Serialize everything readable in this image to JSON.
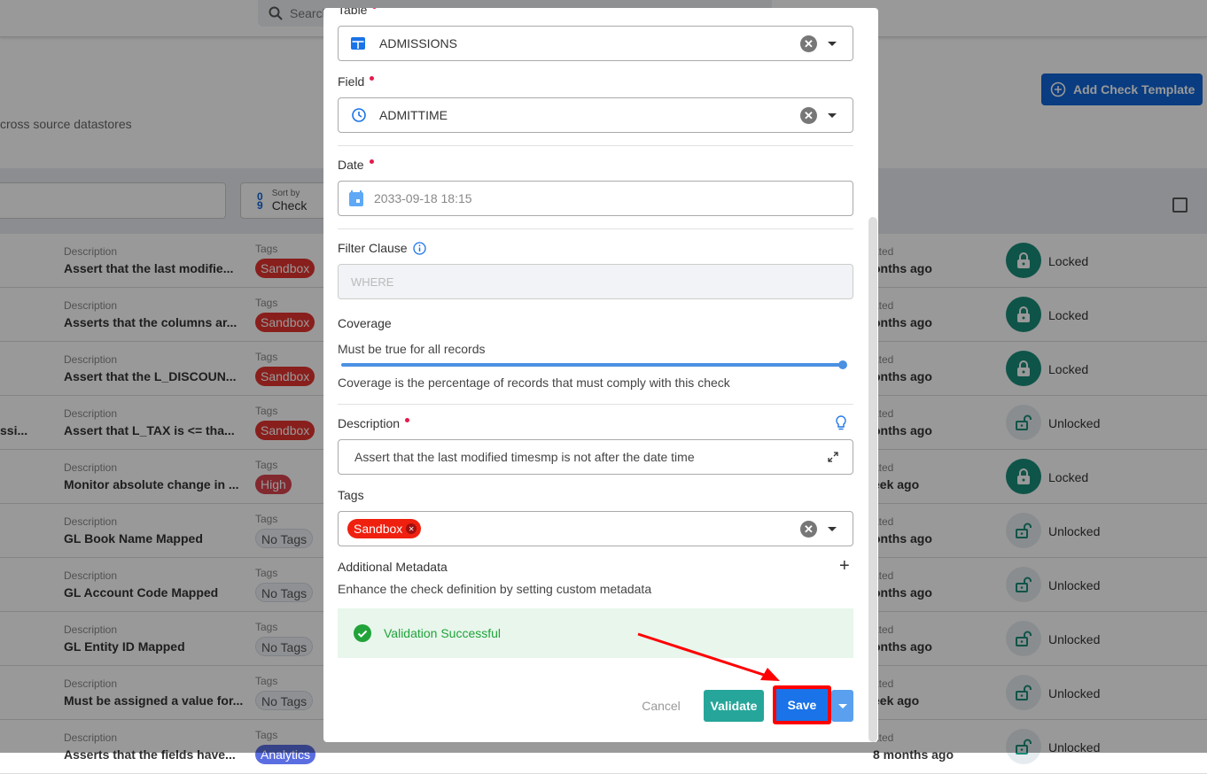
{
  "header": {
    "search_placeholder": "Search"
  },
  "page": {
    "subtitle": "cross source datastores",
    "add_button": "Add Check Template"
  },
  "toolbar": {
    "sort_label": "Sort by",
    "sort_value": "Check"
  },
  "rows": [
    {
      "desc_label": "Description",
      "desc": "Assert that the last modifie...",
      "tags_label": "Tags",
      "tag": "Sandbox",
      "tag_style": "red",
      "updated_label": "ated",
      "updated": "onths ago",
      "lock": "Locked"
    },
    {
      "desc_label": "Description",
      "desc": "Asserts that the columns ar...",
      "tags_label": "Tags",
      "tag": "Sandbox",
      "tag_style": "red",
      "updated_label": "ated",
      "updated": "onths ago",
      "lock": "Locked"
    },
    {
      "desc_label": "Description",
      "desc": "Assert that the L_DISCOUN...",
      "tags_label": "Tags",
      "tag": "Sandbox",
      "tag_style": "red",
      "updated_label": "ated",
      "updated": "onths ago",
      "lock": "Locked"
    },
    {
      "desc_label": "Description",
      "desc": "Assert that L_TAX is <= tha...",
      "tags_label": "Tags",
      "tag": "Sandbox",
      "tag_style": "red",
      "updated_label": "ated",
      "updated": "onths ago",
      "lock": "Unlocked",
      "left": "ssi..."
    },
    {
      "desc_label": "Description",
      "desc": "Monitor absolute change in ...",
      "tags_label": "Tags",
      "tag": "High",
      "tag_style": "high",
      "updated_label": "ated",
      "updated": "eek ago",
      "lock": "Locked"
    },
    {
      "desc_label": "Description",
      "desc": "GL Book Name Mapped",
      "tags_label": "Tags",
      "tag": "No Tags",
      "tag_style": "none",
      "updated_label": "ated",
      "updated": "onths ago",
      "lock": "Unlocked"
    },
    {
      "desc_label": "Description",
      "desc": "GL Account Code Mapped",
      "tags_label": "Tags",
      "tag": "No Tags",
      "tag_style": "none",
      "updated_label": "ated",
      "updated": "onths ago",
      "lock": "Unlocked"
    },
    {
      "desc_label": "Description",
      "desc": "GL Entity ID Mapped",
      "tags_label": "Tags",
      "tag": "No Tags",
      "tag_style": "none",
      "updated_label": "ated",
      "updated": "onths ago",
      "lock": "Unlocked"
    },
    {
      "desc_label": "Description",
      "desc": "Must be assigned a value for...",
      "tags_label": "Tags",
      "tag": "No Tags",
      "tag_style": "none",
      "updated_label": "ated",
      "updated": "eek ago",
      "lock": "Unlocked"
    },
    {
      "desc_label": "Description",
      "desc": "Asserts that the fields have...",
      "tags_label": "Tags",
      "tag": "Analytics",
      "tag_style": "an",
      "updated_label": "ated",
      "updated": "8 months ago",
      "lock": "Unlocked"
    }
  ],
  "modal": {
    "table_label": "Table",
    "table_value": "ADMISSIONS",
    "field_label": "Field",
    "field_value": "ADMITTIME",
    "date_label": "Date",
    "date_value": "2033-09-18 18:15",
    "filter_label": "Filter Clause",
    "filter_placeholder": "WHERE",
    "coverage_label": "Coverage",
    "coverage_text": "Must be true for all records",
    "coverage_value": 1.0,
    "coverage_help": "Coverage is the percentage of records that must comply with this check",
    "description_label": "Description",
    "description_value": "Assert that the last modified timesmp is not after the date time",
    "tags_label": "Tags",
    "tags": [
      "Sandbox"
    ],
    "metadata_label": "Additional Metadata",
    "metadata_help": "Enhance the check definition by setting custom metadata",
    "validation": "Validation Successful",
    "cancel": "Cancel",
    "validate": "Validate",
    "save": "Save"
  },
  "colors": {
    "primary": "#0f64d6",
    "success": "#21a33a",
    "teal": "#26a69a",
    "highlight": "#ff0000",
    "sandbox": "#e3342f"
  }
}
